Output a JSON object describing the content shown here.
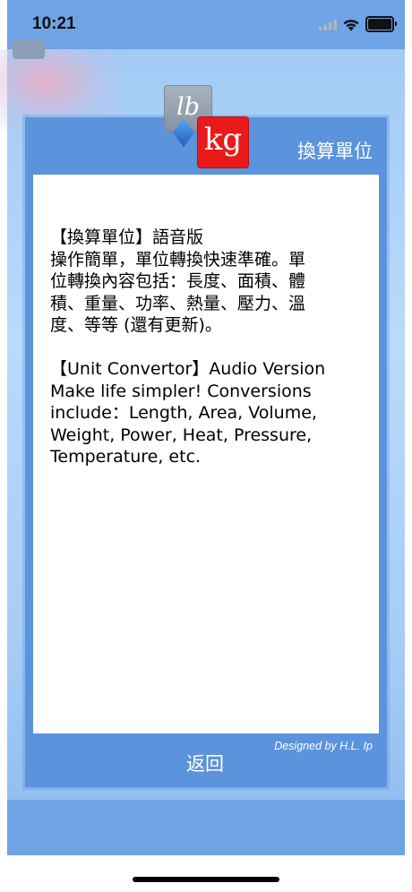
{
  "status_bar": {
    "time": "10:21",
    "signal_icon": "cellular-signal-icon",
    "wifi_icon": "wifi-icon",
    "battery_icon": "battery-icon"
  },
  "dialog": {
    "title": "換算單位",
    "logo": {
      "lb_text": "lb",
      "kg_text": "kg"
    },
    "content": {
      "zh_lines": [
        "【換算單位】語音版",
        "操作簡單，單位轉換快速準確。單",
        "位轉換內容包括：長度、面積、體",
        "積、重量、功率、熱量、壓力、溫",
        "度、等等 (還有更新)。"
      ],
      "en_lines": [
        "【Unit Convertor】Audio Version",
        "Make life simpler! Conversions",
        "include：Length, Area, Volume,",
        "Weight, Power, Heat, Pressure,",
        "Temperature, etc."
      ]
    },
    "back_label": "返回",
    "credit": "Designed by H.L. Ip"
  },
  "colors": {
    "dialog_bg": "#5b93dc",
    "kg_red": "#ea1a1a",
    "lb_gray": "#8c98a8",
    "bar_blue": "#6ea3e6"
  }
}
